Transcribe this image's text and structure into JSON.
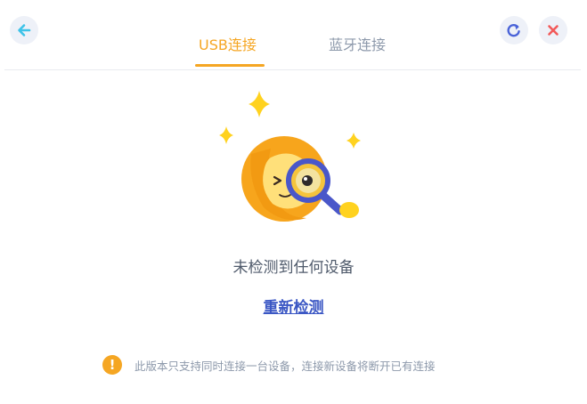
{
  "header": {
    "back_icon": "arrow-left-icon",
    "refresh_icon": "refresh-icon",
    "close_icon": "close-icon"
  },
  "tabs": [
    {
      "label": "USB连接",
      "active": true
    },
    {
      "label": "蓝牙连接",
      "active": false
    }
  ],
  "main": {
    "illustration": "searching-magnifier-mascot",
    "status_text": "未检测到任何设备",
    "retry_label": "重新检测"
  },
  "notice": {
    "icon": "warning-icon",
    "icon_glyph": "!",
    "text": "此版本只支持同时连接一台设备，连接新设备将断开已有连接"
  },
  "colors": {
    "accent": "#f5a623",
    "link": "#3b57c4",
    "back_arrow": "#3ec3e8",
    "refresh": "#4a63d8",
    "close": "#f25a5a"
  }
}
